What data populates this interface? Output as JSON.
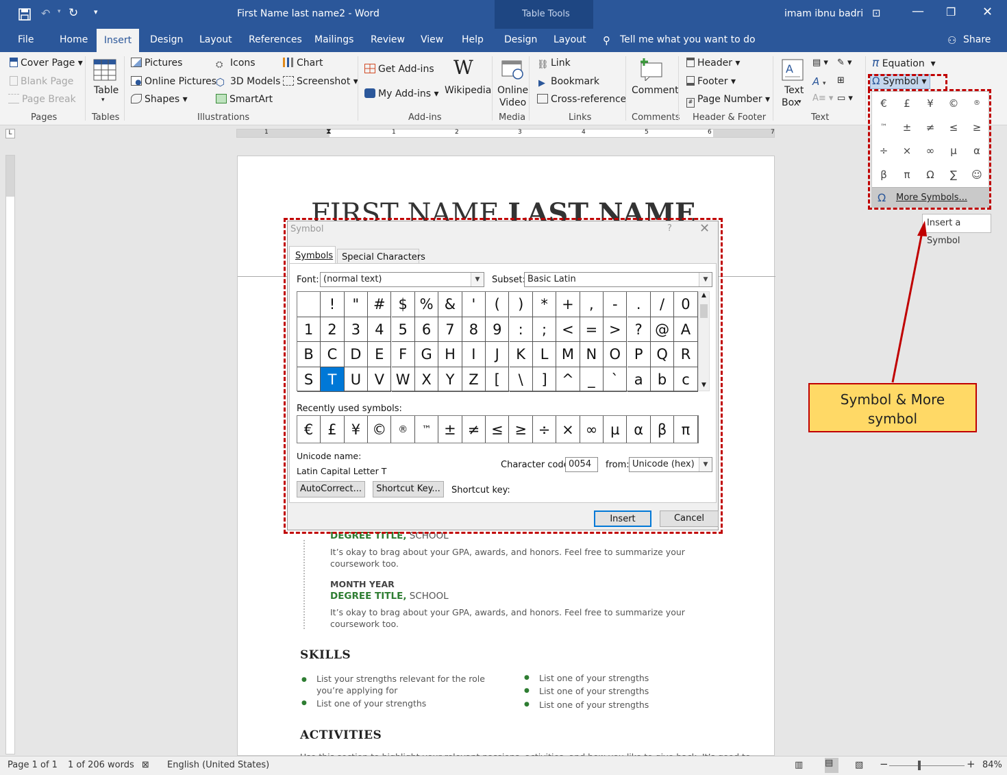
{
  "window": {
    "title": "First Name last name2  -  Word",
    "context_tab": "Table Tools",
    "user": "imam ibnu badri"
  },
  "tabs": [
    "File",
    "Home",
    "Insert",
    "Design",
    "Layout",
    "References",
    "Mailings",
    "Review",
    "View",
    "Help",
    "Design",
    "Layout"
  ],
  "tell_me": "Tell me what you want to do",
  "share": "Share",
  "ribbon": {
    "pages": {
      "cover_page": "Cover Page",
      "blank_page": "Blank Page",
      "page_break": "Page Break",
      "group": "Pages"
    },
    "tables": {
      "table": "Table",
      "group": "Tables"
    },
    "illustrations": {
      "pictures": "Pictures",
      "online_pictures": "Online Pictures",
      "shapes": "Shapes",
      "icons": "Icons",
      "models": "3D Models",
      "smartart": "SmartArt",
      "chart": "Chart",
      "screenshot": "Screenshot",
      "group": "Illustrations"
    },
    "addins": {
      "get": "Get Add-ins",
      "my": "My Add-ins",
      "wikipedia": "Wikipedia",
      "group": "Add-ins"
    },
    "media": {
      "online_video_1": "Online",
      "online_video_2": "Video",
      "group": "Media"
    },
    "links": {
      "link": "Link",
      "bookmark": "Bookmark",
      "cross_reference": "Cross-reference",
      "group": "Links"
    },
    "comments": {
      "comment": "Comment",
      "group": "Comments"
    },
    "header_footer": {
      "header": "Header",
      "footer": "Footer",
      "page_number": "Page Number",
      "group": "Header & Footer"
    },
    "text": {
      "text_box_1": "Text",
      "text_box_2": "Box",
      "group": "Text"
    },
    "symbols": {
      "equation": "Equation",
      "symbol": "Symbol"
    }
  },
  "gallery": {
    "symbols": [
      "€",
      "£",
      "¥",
      "©",
      "®",
      "™",
      "±",
      "≠",
      "≤",
      "≥",
      "÷",
      "×",
      "∞",
      "µ",
      "α",
      "β",
      "π",
      "Ω",
      "∑",
      "☺"
    ],
    "more": "More Symbols...",
    "tooltip": "Insert a Symbol"
  },
  "ruler": [
    "1",
    "1",
    "2",
    "3",
    "4",
    "5",
    "6",
    "7"
  ],
  "document": {
    "heading_light": "FIRST NAME",
    "heading_bold": "LAST NAME",
    "degree1_title": "DEGREE TITLE,",
    "degree1_school": " SCHOOL",
    "degree1_body": "It’s okay to brag about your GPA, awards, and honors. Feel free to summarize your coursework too.",
    "month_year": "MONTH YEAR",
    "degree2_title": "DEGREE TITLE,",
    "degree2_school": " SCHOOL",
    "degree2_body": "It’s okay to brag about your GPA, awards, and honors. Feel free to summarize your coursework too.",
    "skills_heading": "SKILLS",
    "skills_left": [
      "List your strengths relevant for the role you’re applying for",
      "List one of your strengths"
    ],
    "skills_right": [
      "List one of your strengths",
      "List one of your strengths",
      "List one of your strengths"
    ],
    "activities_heading": "ACTIVITIES",
    "activities_body": "Use this section to highlight your relevant passions, activities, and how you like to give back. It’s good to"
  },
  "dialog": {
    "title": "Symbol",
    "help": "?",
    "tab_symbols": "Symbols",
    "tab_special": "Special Characters",
    "font_label": "Font:",
    "font_value": "(normal text)",
    "subset_label": "Subset:",
    "subset_value": "Basic Latin",
    "grid": [
      [
        "",
        " ",
        "!",
        "\"",
        "#",
        "$",
        "%",
        "&",
        "'",
        "(",
        ")",
        "*",
        "+",
        ",",
        "-",
        ".",
        "/",
        "0"
      ],
      [
        "1",
        "2",
        "3",
        "4",
        "5",
        "6",
        "7",
        "8",
        "9",
        ":",
        ";",
        "<",
        "=",
        ">",
        "?",
        "@",
        "A"
      ],
      [
        "B",
        "C",
        "D",
        "E",
        "F",
        "G",
        "H",
        "I",
        "J",
        "K",
        "L",
        "M",
        "N",
        "O",
        "P",
        "Q",
        "R"
      ],
      [
        "S",
        "T",
        "U",
        "V",
        "W",
        "X",
        "Y",
        "Z",
        "[",
        "\\",
        "]",
        "^",
        "_",
        "`",
        "a",
        "b",
        "c"
      ]
    ],
    "selected": "T",
    "recent_label": "Recently used symbols:",
    "recent": [
      "€",
      "£",
      "¥",
      "©",
      "®",
      "™",
      "±",
      "≠",
      "≤",
      "≥",
      "÷",
      "×",
      "∞",
      "µ",
      "α",
      "β",
      "π"
    ],
    "unicode_label": "Unicode name:",
    "unicode_value": "Latin Capital Letter T",
    "char_code_label": "Character code:",
    "char_code_value": "0054",
    "from_label": "from:",
    "from_value": "Unicode (hex)",
    "autocorrect": "AutoCorrect...",
    "shortcut_key_btn": "Shortcut Key...",
    "shortcut_key_label": "Shortcut key:",
    "insert": "Insert",
    "cancel": "Cancel"
  },
  "callout": {
    "line1": "Symbol & More",
    "line2": "symbol"
  },
  "status": {
    "page": "Page 1 of 1",
    "words": "1 of 206 words",
    "language": "English (United States)",
    "zoom": "84%"
  },
  "colors": {
    "accent": "#2b579a",
    "highlight": "#c00000",
    "callout": "#ffd966",
    "green": "#2e7d32",
    "selected": "#0078d7"
  }
}
